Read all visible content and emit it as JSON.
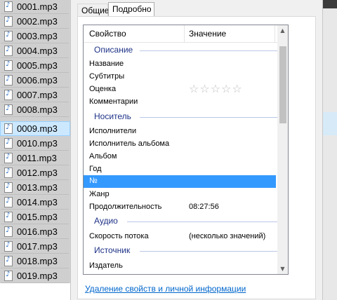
{
  "file_list": [
    "0001.mp3",
    "0002.mp3",
    "0003.mp3",
    "0004.mp3",
    "0005.mp3",
    "0006.mp3",
    "0007.mp3",
    "0008.mp3",
    "0009.mp3",
    "0010.mp3",
    "0011.mp3",
    "0012.mp3",
    "0013.mp3",
    "0014.mp3",
    "0015.mp3",
    "0016.mp3",
    "0017.mp3",
    "0018.mp3",
    "0019.mp3"
  ],
  "tabs": {
    "general": "Общие",
    "details": "Подробно"
  },
  "grid": {
    "col_property": "Свойство",
    "col_value": "Значение",
    "groups": {
      "description": "Описание",
      "media": "Носитель",
      "audio": "Аудио",
      "origin": "Источник"
    },
    "rows": {
      "title": "Название",
      "subtitle": "Субтитры",
      "rating": "Оценка",
      "comments": "Комментарии",
      "contributing_artists": "Исполнители",
      "album_artist": "Исполнитель альбома",
      "album": "Альбом",
      "year": "Год",
      "track_number": "№",
      "genre": "Жанр",
      "length": "Продолжительность",
      "length_value": "08:27:56",
      "bitrate": "Скорость потока",
      "bitrate_value": "(несколько значений)",
      "publisher": "Издатель"
    },
    "rating_stars": "☆☆☆☆☆"
  },
  "remove_link": "Удаление свойств и личной информации"
}
